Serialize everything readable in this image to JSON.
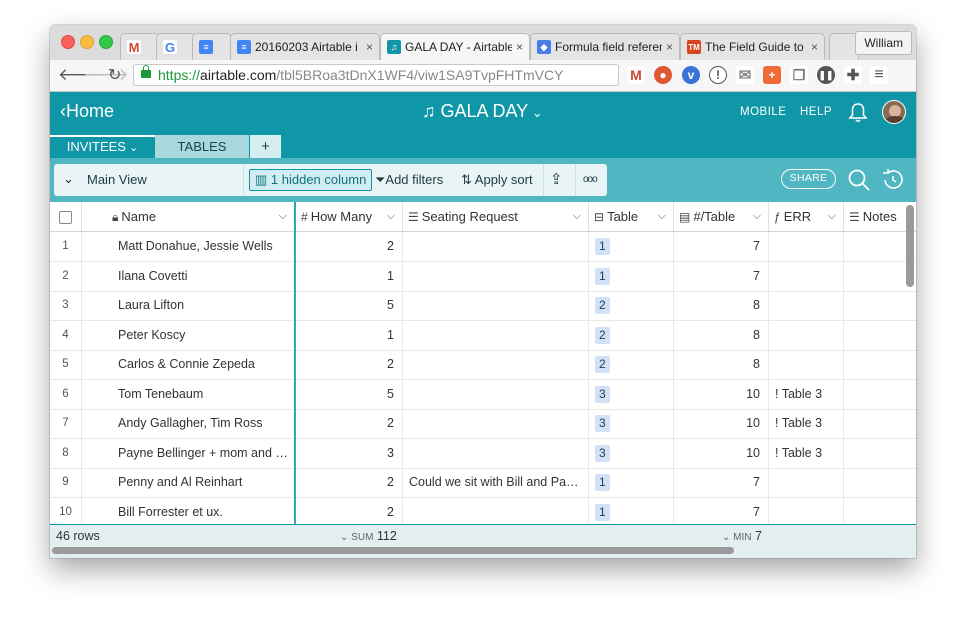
{
  "browser": {
    "tabs": [
      {
        "title": "",
        "favicon": "gmail-icon",
        "color": "#d14836"
      },
      {
        "title": "",
        "favicon": "google-icon",
        "color": "#4285f4"
      },
      {
        "title": "",
        "favicon": "google-docs-icon",
        "color": "#4285f4"
      },
      {
        "title": "20160203 Airtable i",
        "favicon": "google-docs-icon",
        "color": "#4285f4"
      },
      {
        "title": "GALA DAY - Airtable",
        "favicon": "airtable-icon",
        "color": "#1097a7"
      },
      {
        "title": "Formula field referen",
        "favicon": "airtable-icon",
        "color": "#4a7de6"
      },
      {
        "title": "The Field Guide to Te",
        "favicon": "tm-icon",
        "color": "#d8451f"
      }
    ],
    "profile_name": "William",
    "url_scheme": "https://",
    "url_host": "airtable.com",
    "url_path": "/tbl5BRoa3tDnX1WF4/viw1SA9TvpFHTmVCY"
  },
  "app": {
    "home_label": "Home",
    "base_name": "GALA DAY",
    "mobile_label": "MOBILE",
    "help_label": "HELP",
    "header_color": "#1097a7",
    "tables": [
      {
        "label": "INVITEES"
      },
      {
        "label": "TABLES"
      }
    ],
    "add_table_label": "+"
  },
  "viewbar": {
    "view_name": "Main View",
    "hidden_column_label": "1 hidden column",
    "filter_label": "Add filters",
    "sort_label": "Apply sort",
    "more_label": "ooo",
    "share_label": "SHARE"
  },
  "columns": [
    {
      "name": "Name",
      "icon": "lock-icon"
    },
    {
      "name": "How Many",
      "icon": "number-icon"
    },
    {
      "name": "Seating Request",
      "icon": "long-text-icon"
    },
    {
      "name": "Table",
      "icon": "link-icon"
    },
    {
      "name": "#/Table",
      "icon": "lookup-icon"
    },
    {
      "name": "ERR",
      "icon": "formula-icon"
    },
    {
      "name": "Notes",
      "icon": "long-text-icon"
    }
  ],
  "rows": [
    {
      "num": "1",
      "name": "Matt Donahue, Jessie Wells",
      "how_many": "2",
      "seating": "",
      "table": "1",
      "per_table": "7",
      "err": "",
      "notes": ""
    },
    {
      "num": "2",
      "name": "Ilana Covetti",
      "how_many": "1",
      "seating": "",
      "table": "1",
      "per_table": "7",
      "err": "",
      "notes": ""
    },
    {
      "num": "3",
      "name": "Laura Lifton",
      "how_many": "5",
      "seating": "",
      "table": "2",
      "per_table": "8",
      "err": "",
      "notes": ""
    },
    {
      "num": "4",
      "name": "Peter Koscy",
      "how_many": "1",
      "seating": "",
      "table": "2",
      "per_table": "8",
      "err": "",
      "notes": ""
    },
    {
      "num": "5",
      "name": "Carlos & Connie Zepeda",
      "how_many": "2",
      "seating": "",
      "table": "2",
      "per_table": "8",
      "err": "",
      "notes": ""
    },
    {
      "num": "6",
      "name": "Tom Tenebaum",
      "how_many": "5",
      "seating": "",
      "table": "3",
      "per_table": "10",
      "err": "! Table 3",
      "notes": ""
    },
    {
      "num": "7",
      "name": "Andy Gallagher, Tim Ross",
      "how_many": "2",
      "seating": "",
      "table": "3",
      "per_table": "10",
      "err": "! Table 3",
      "notes": ""
    },
    {
      "num": "8",
      "name": "Payne Bellinger + mom and d…",
      "how_many": "3",
      "seating": "",
      "table": "3",
      "per_table": "10",
      "err": "! Table 3",
      "notes": ""
    },
    {
      "num": "9",
      "name": "Penny and Al Reinhart",
      "how_many": "2",
      "seating": "Could we sit with Bill and Pau…",
      "table": "1",
      "per_table": "7",
      "err": "",
      "notes": ""
    },
    {
      "num": "10",
      "name": "Bill Forrester et ux.",
      "how_many": "2",
      "seating": "",
      "table": "1",
      "per_table": "7",
      "err": "",
      "notes": ""
    }
  ],
  "footer": {
    "row_count": "46 rows",
    "sum_label": "SUM",
    "sum_value": "112",
    "min_label": "MIN",
    "min_value": "7"
  }
}
